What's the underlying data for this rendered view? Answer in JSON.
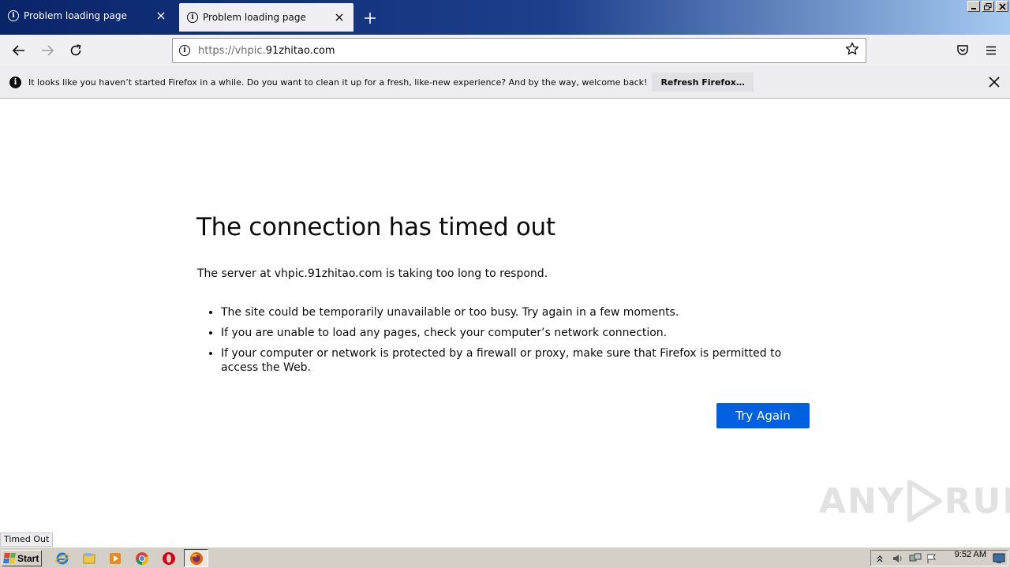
{
  "tabs": [
    {
      "label": "Problem loading page",
      "active": false
    },
    {
      "label": "Problem loading page",
      "active": true
    }
  ],
  "url": {
    "scheme": "https://",
    "host_prefix": "vhpic.",
    "host_main": "91zhitao.com"
  },
  "notification": {
    "text": "It looks like you haven’t started Firefox in a while. Do you want to clean it up for a fresh, like-new experience? And by the way, welcome back!",
    "button_label": "Refresh Firefox…"
  },
  "error": {
    "title": "The connection has timed out",
    "description": "The server at vhpic.91zhitao.com is taking too long to respond.",
    "bullets": [
      "The site could be temporarily unavailable or too busy. Try again in a few moments.",
      "If you are unable to load any pages, check your computer’s network connection.",
      "If your computer or network is protected by a firewall or proxy, make sure that Firefox is permitted to access the Web."
    ],
    "button_label": "Try Again"
  },
  "status_tip": "Timed Out",
  "watermark": {
    "left": "ANY",
    "right": "RUN"
  },
  "taskbar": {
    "start_label": "Start",
    "clock": "9:52 AM"
  },
  "colors": {
    "accent": "#0060df",
    "titlebar": "#0a246a"
  }
}
